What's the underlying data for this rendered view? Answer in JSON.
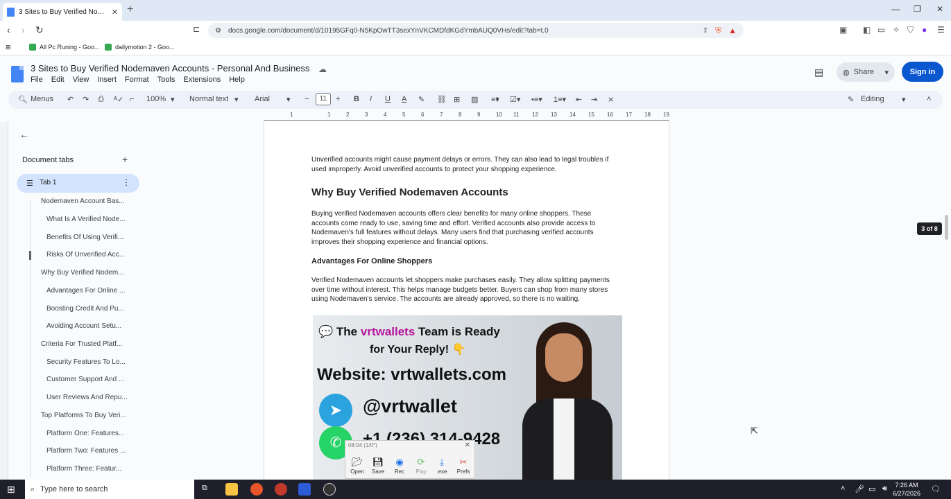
{
  "browser": {
    "tab_title": "3 Sites to Buy Verified Nodemaven",
    "tab_close": "✕",
    "new_tab": "+",
    "url": "docs.google.com/document/d/10195GFq0-N5KpOwTT3sexYnVKCMDfdKGdYmbAUQ0VHs/edit?tab=t.0",
    "bookmarks": [
      "All Pc Runing - Goo...",
      "dailymotion 2 - Goo..."
    ]
  },
  "docs": {
    "title": "3 Sites to Buy Verified Nodemaven Accounts - Personal And Business",
    "menus": [
      "File",
      "Edit",
      "View",
      "Insert",
      "Format",
      "Tools",
      "Extensions",
      "Help"
    ],
    "share_label": "Share",
    "signin_label": "Sign in"
  },
  "toolbar": {
    "menus_label": "Menus",
    "zoom": "100%",
    "style": "Normal text",
    "font": "Arial",
    "font_size": "11",
    "mode": "Editing"
  },
  "sidebar": {
    "header": "Document tabs",
    "tab_label": "Tab 1",
    "outline": [
      {
        "label": "Nodemaven Account Bas...",
        "level": 1
      },
      {
        "label": "What Is A Verified Node...",
        "level": 2
      },
      {
        "label": "Benefits Of Using Verifi...",
        "level": 2
      },
      {
        "label": "Risks Of Unverified Acc...",
        "level": 2
      },
      {
        "label": "Why Buy Verified Nodem...",
        "level": 1
      },
      {
        "label": "Advantages For Online ...",
        "level": 2
      },
      {
        "label": "Boosting Credit And Pu...",
        "level": 2
      },
      {
        "label": "Avoiding Account Setu...",
        "level": 2
      },
      {
        "label": "Criteria For Trusted Platf...",
        "level": 1
      },
      {
        "label": "Security Features To Lo...",
        "level": 2
      },
      {
        "label": "Customer Support And ...",
        "level": 2
      },
      {
        "label": "User Reviews And Repu...",
        "level": 2
      },
      {
        "label": "Top Platforms To Buy Veri...",
        "level": 1
      },
      {
        "label": "Platform One: Features...",
        "level": 2
      },
      {
        "label": "Platform Two: Features ...",
        "level": 2
      },
      {
        "label": "Platform Three: Featur...",
        "level": 2
      }
    ]
  },
  "ruler": {
    "ticks": [
      "1",
      "1",
      "2",
      "3",
      "4",
      "5",
      "6",
      "7",
      "8",
      "9",
      "10",
      "11",
      "12",
      "13",
      "14",
      "15",
      "16",
      "17",
      "18",
      "19"
    ]
  },
  "document": {
    "para1": "Unverified accounts might cause payment delays or errors. They can also lead to legal troubles if used improperly. Avoid unverified accounts to protect your shopping experience.",
    "heading1": "Why Buy Verified Nodemaven Accounts",
    "para2": "Buying verified Nodemaven accounts offers clear benefits for many online shoppers. These accounts come ready to use, saving time and effort. Verified accounts also provide access to Nodemaven's full features without delays. Many users find that purchasing verified accounts improves their shopping experience and financial options.",
    "heading2": "Advantages For Online Shoppers",
    "para3": "Verified Nodemaven accounts let shoppers make purchases easily. They allow splitting payments over time without interest. This helps manage budgets better. Buyers can shop from many stores using Nodemaven's service. The accounts are already approved, so there is no waiting."
  },
  "promo": {
    "line1_pre": "The",
    "line1_brand": "vrtwallets",
    "line1_post": "Team is Ready",
    "line2": "for Your Reply! 👇",
    "website": "Website: vrtwallets.com",
    "telegram": "@vrtwallet",
    "phone": "+1 (236) 314-9428"
  },
  "recorder": {
    "title": "08:04 (1/0*)",
    "buttons": [
      "Open",
      "Save",
      "Rec",
      "Play",
      ".exe",
      "Prefs"
    ]
  },
  "page_count": "3 of 8",
  "taskbar": {
    "search_placeholder": "Type here to search",
    "time": "7:26 AM",
    "date": "6/27/2026"
  }
}
